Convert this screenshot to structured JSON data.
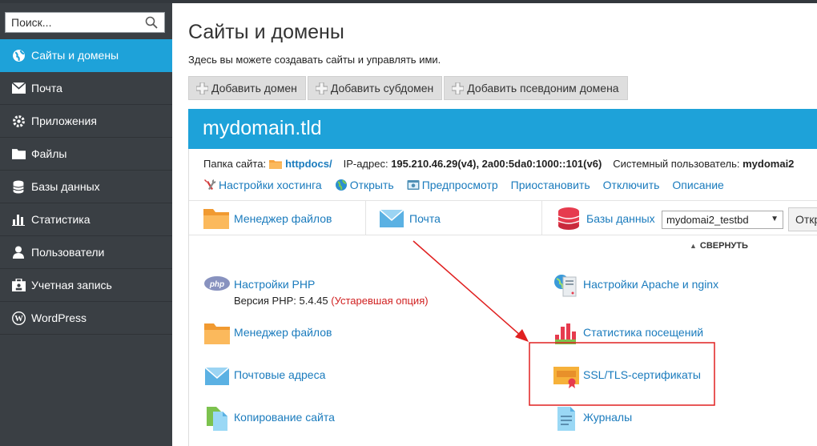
{
  "sidebar": {
    "search_placeholder": "Поиск...",
    "items": [
      {
        "label": "Сайты и домены",
        "icon": "globe-icon",
        "active": true
      },
      {
        "label": "Почта",
        "icon": "mail-icon"
      },
      {
        "label": "Приложения",
        "icon": "gear-icon"
      },
      {
        "label": "Файлы",
        "icon": "folder-icon"
      },
      {
        "label": "Базы данных",
        "icon": "database-icon"
      },
      {
        "label": "Статистика",
        "icon": "bar-chart-icon"
      },
      {
        "label": "Пользователи",
        "icon": "user-icon"
      },
      {
        "label": "Учетная запись",
        "icon": "account-icon"
      },
      {
        "label": "WordPress",
        "icon": "wordpress-icon"
      }
    ]
  },
  "main": {
    "title": "Сайты и домены",
    "description": "Здесь вы можете создавать сайты и управлять ими.",
    "toolbar": {
      "add_domain": "Добавить домен",
      "add_subdomain": "Добавить субдомен",
      "add_alias": "Добавить псевдоним домена"
    }
  },
  "domain": {
    "name": "mydomain.tld",
    "folder_label": "Папка сайта:",
    "folder_value": "httpdocs/",
    "ip_label": "IP-адрес:",
    "ip_value": "195.210.46.29(v4), 2a00:5da0:1000::101(v6)",
    "sysuser_label": "Системный пользователь:",
    "sysuser_value": "mydomai2",
    "actions": {
      "hosting": "Настройки хостинга",
      "open": "Открыть",
      "preview": "Предпросмотр",
      "suspend": "Приостановить",
      "disable": "Отключить",
      "description": "Описание"
    },
    "quick": {
      "file_manager": "Менеджер файлов",
      "mail": "Почта",
      "databases": "Базы данных",
      "db_selected": "mydomai2_testbd",
      "db_open": "Откр"
    },
    "collapse": "СВЕРНУТЬ",
    "tools": {
      "php": "Настройки PHP",
      "php_version_label": "Версия PHP: 5.4.45",
      "php_version_note": "(Устаревшая опция)",
      "apache": "Настройки Apache и nginx",
      "file_manager": "Менеджер файлов",
      "stats": "Статистика посещений",
      "mail_addresses": "Почтовые адреса",
      "ssl": "SSL/TLS-сертификаты",
      "copy": "Копирование сайта",
      "logs": "Журналы"
    }
  },
  "colors": {
    "accent": "#1ea2d9",
    "sidebar_bg": "#3a3f44",
    "link": "#1a7bbd",
    "warning": "#d01f1f",
    "annotation": "#e02020"
  }
}
